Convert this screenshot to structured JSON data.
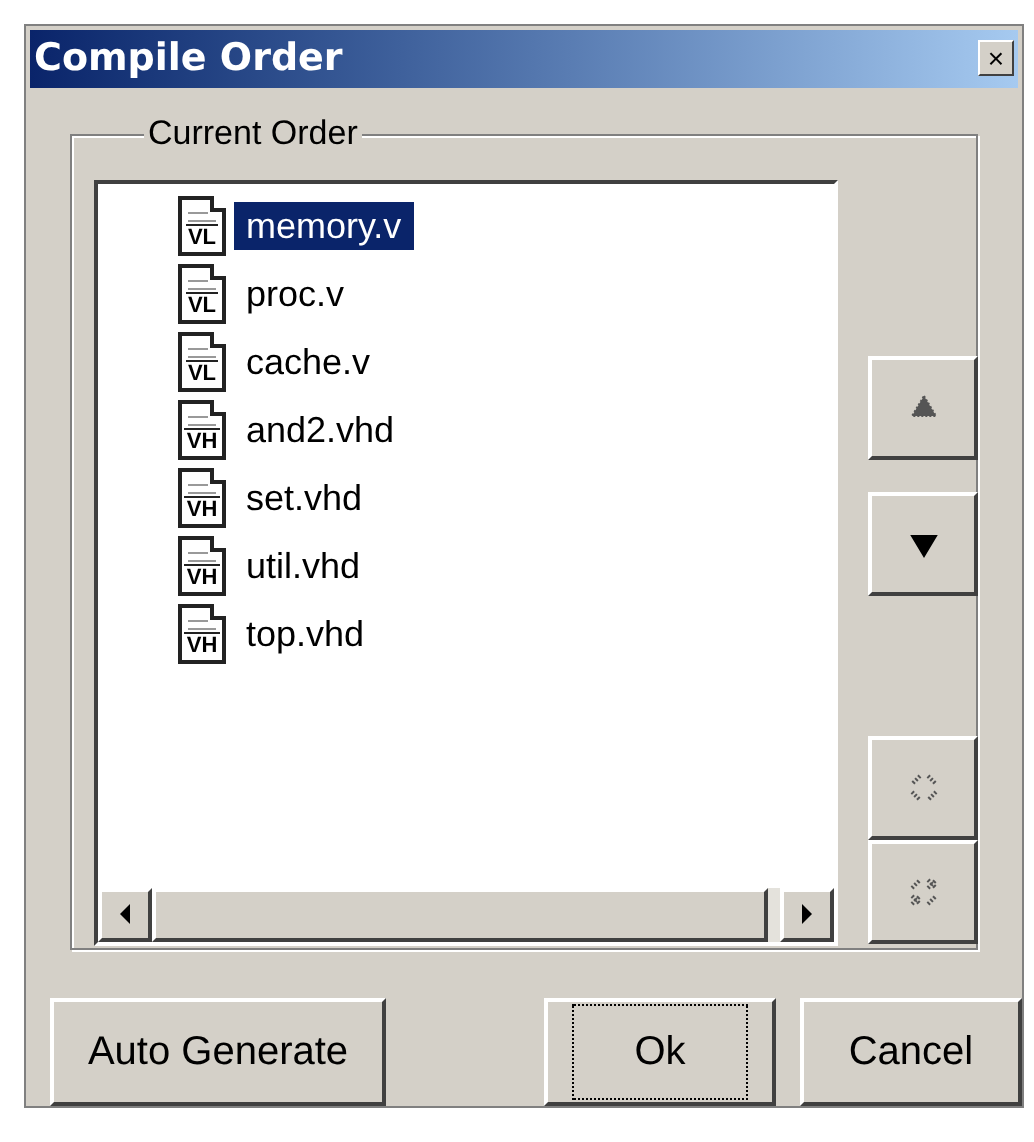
{
  "window": {
    "title": "Compile Order",
    "close": "×"
  },
  "group": {
    "label": "Current Order"
  },
  "files": [
    {
      "name": "memory.v",
      "badge": "VL",
      "selected": true
    },
    {
      "name": "proc.v",
      "badge": "VL",
      "selected": false
    },
    {
      "name": "cache.v",
      "badge": "VL",
      "selected": false
    },
    {
      "name": "and2.vhd",
      "badge": "VH",
      "selected": false
    },
    {
      "name": "set.vhd",
      "badge": "VH",
      "selected": false
    },
    {
      "name": "util.vhd",
      "badge": "VH",
      "selected": false
    },
    {
      "name": "top.vhd",
      "badge": "VH",
      "selected": false
    }
  ],
  "side_buttons": [
    {
      "kind": "up",
      "disabled": true
    },
    {
      "kind": "down",
      "disabled": false
    },
    {
      "kind": "collapse",
      "disabled": true
    },
    {
      "kind": "expand",
      "disabled": true
    }
  ],
  "buttons": [
    {
      "label": "Auto Generate",
      "focused": false
    },
    {
      "label": "Ok",
      "focused": true
    },
    {
      "label": "Cancel",
      "focused": false
    }
  ]
}
